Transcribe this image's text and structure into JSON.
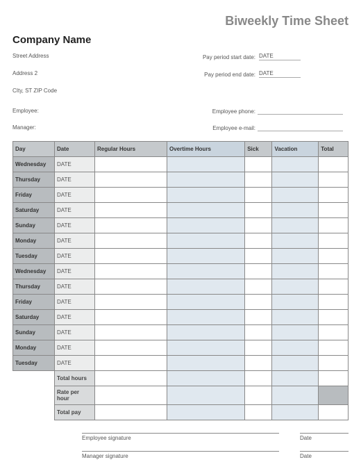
{
  "title": "Biweekly Time Sheet",
  "company": "Company Name",
  "labels": {
    "street": "Street Address",
    "address2": "Address 2",
    "cityzip": "CIty, ST  ZIP Code",
    "employee": "Employee:",
    "manager": "Manager:",
    "payStart": "Pay period start date:",
    "payEnd": "Pay period end date:",
    "empPhone": "Employee phone:",
    "empEmail": "Employee e-mail:"
  },
  "payStartValue": "DATE",
  "payEndValue": "DATE",
  "columns": {
    "day": "Day",
    "date": "Date",
    "reg": "Regular Hours",
    "ot": "Overtime Hours",
    "sick": "Sick",
    "vac": "Vacation",
    "tot": "Total"
  },
  "rows": [
    {
      "day": "Wednesday",
      "date": "DATE"
    },
    {
      "day": "Thursday",
      "date": "DATE"
    },
    {
      "day": "Friday",
      "date": "DATE"
    },
    {
      "day": "Saturday",
      "date": "DATE"
    },
    {
      "day": "Sunday",
      "date": "DATE"
    },
    {
      "day": "Monday",
      "date": "DATE"
    },
    {
      "day": "Tuesday",
      "date": "DATE"
    },
    {
      "day": "Wednesday",
      "date": "DATE"
    },
    {
      "day": "Thursday",
      "date": "DATE"
    },
    {
      "day": "Friday",
      "date": "DATE"
    },
    {
      "day": "Saturday",
      "date": "DATE"
    },
    {
      "day": "Sunday",
      "date": "DATE"
    },
    {
      "day": "Monday",
      "date": "DATE"
    },
    {
      "day": "Tuesday",
      "date": "DATE"
    }
  ],
  "summary": {
    "totalHours": "Total hours",
    "ratePerHour": "Rate per hour",
    "totalPay": "Total pay"
  },
  "sig": {
    "emp": "Employee signature",
    "mgr": "Manager signature",
    "date": "Date"
  }
}
